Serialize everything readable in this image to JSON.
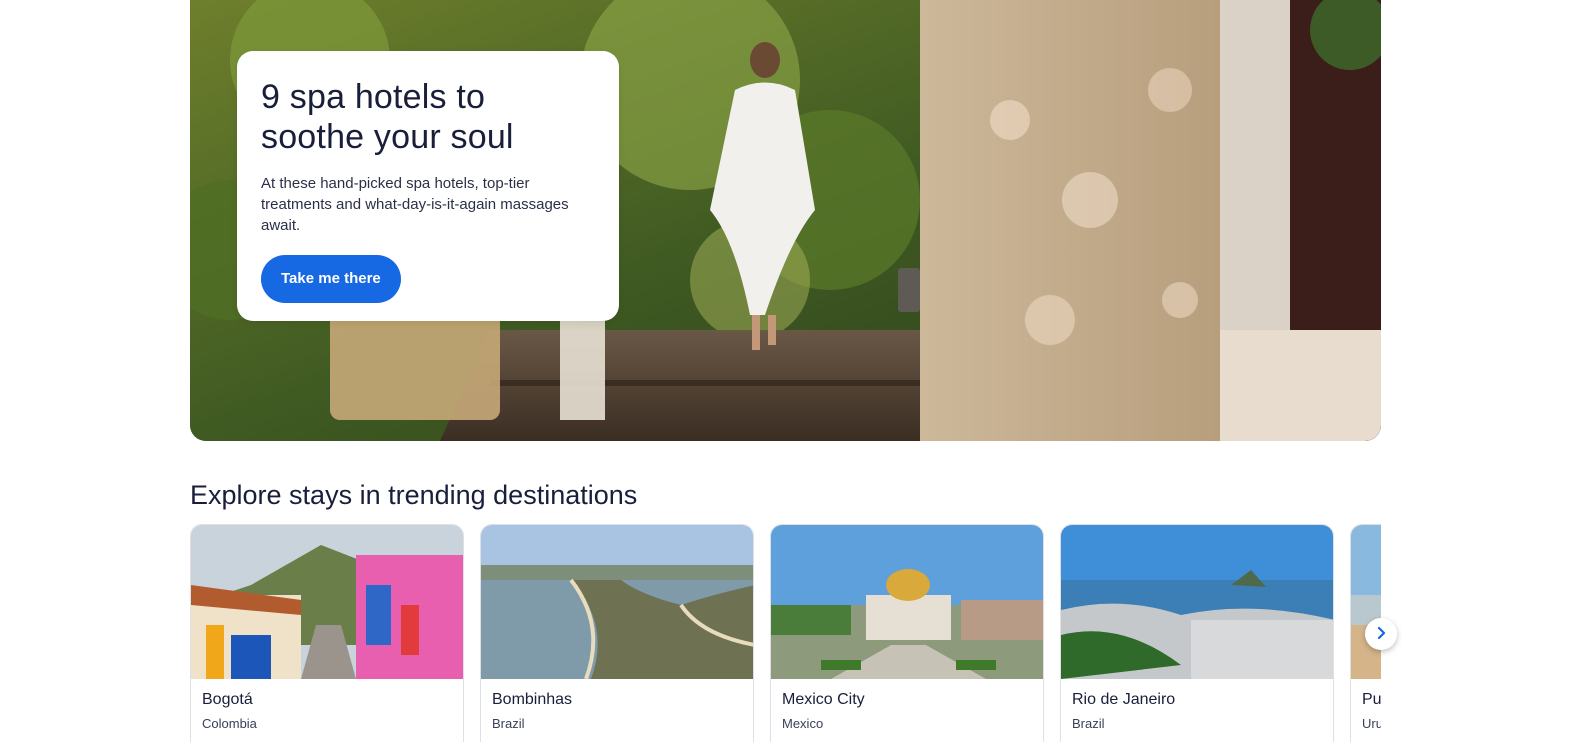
{
  "hero": {
    "title": "9 spa hotels to soothe your soul",
    "description": "At these hand-picked spa hotels, top-tier treatments and what-day-is-it-again massages await.",
    "cta_label": "Take me there"
  },
  "trending": {
    "title": "Explore stays in trending destinations",
    "destinations": [
      {
        "name": "Bogotá",
        "country": "Colombia"
      },
      {
        "name": "Bombinhas",
        "country": "Brazil"
      },
      {
        "name": "Mexico City",
        "country": "Mexico"
      },
      {
        "name": "Rio de Janeiro",
        "country": "Brazil"
      },
      {
        "name": "Punta del Este",
        "country": "Uruguay"
      }
    ],
    "next_icon": "chevron-right-icon"
  },
  "colors": {
    "primary_button": "#1668e3",
    "text_dark": "#191e3b",
    "card_border": "#dfe0e4"
  }
}
